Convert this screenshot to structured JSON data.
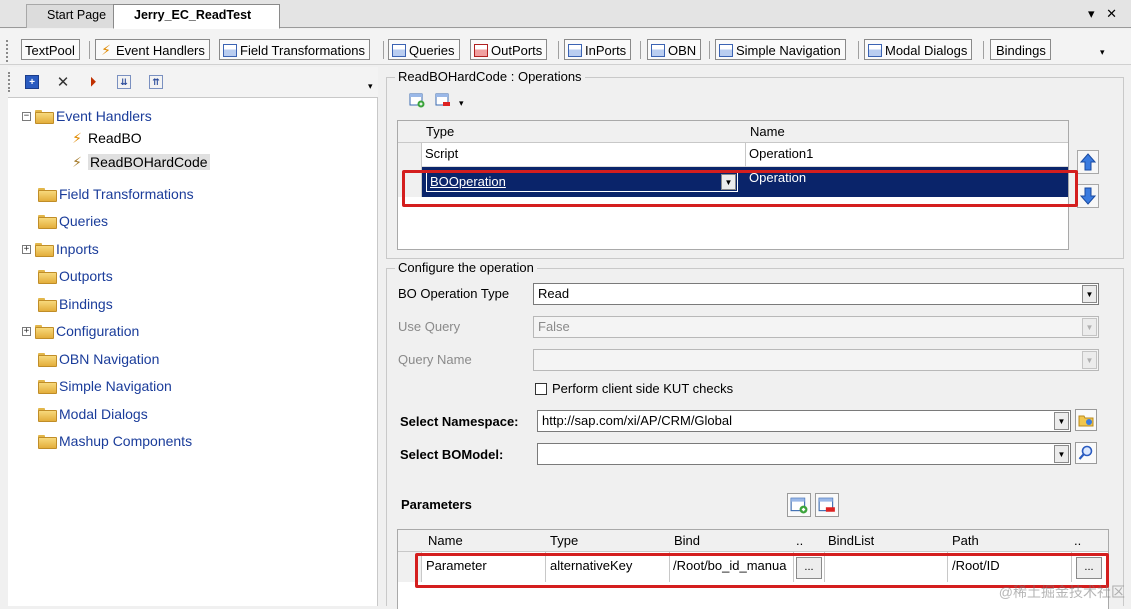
{
  "doc_tabs": {
    "start": "Start Page",
    "active": "Jerry_EC_ReadTest",
    "controls": "▾ ✕"
  },
  "toolbar": {
    "buttons": [
      "TextPool",
      "Event Handlers",
      "Field Transformations",
      "Queries",
      "OutPorts",
      "InPorts",
      "OBN",
      "Simple Navigation",
      "Modal Dialogs",
      "Bindings"
    ]
  },
  "tree": {
    "items": [
      {
        "label": "Event Handlers"
      },
      {
        "label": "ReadBO"
      },
      {
        "label": "ReadBOHardCode"
      },
      {
        "label": "Field Transformations"
      },
      {
        "label": "Queries"
      },
      {
        "label": "Inports"
      },
      {
        "label": "Outports"
      },
      {
        "label": "Bindings"
      },
      {
        "label": "Configuration"
      },
      {
        "label": "OBN Navigation"
      },
      {
        "label": "Simple Navigation"
      },
      {
        "label": "Modal Dialogs"
      },
      {
        "label": "Mashup Components"
      }
    ]
  },
  "operations": {
    "title": "ReadBOHardCode : Operations",
    "columns": {
      "type": "Type",
      "name": "Name"
    },
    "rows": [
      {
        "type": "Script",
        "name": "Operation1"
      },
      {
        "type": "BOOperation",
        "name": "Operation"
      }
    ]
  },
  "configure": {
    "title": "Configure the operation",
    "bo_operation_type_label": "BO Operation Type",
    "bo_operation_type_value": "Read",
    "use_query_label": "Use Query",
    "use_query_value": "False",
    "query_name_label": "Query Name",
    "query_name_value": "",
    "kut_checkbox_label": "Perform client side KUT checks",
    "namespace_label": "Select Namespace:",
    "namespace_value": "http://sap.com/xi/AP/CRM/Global",
    "bomodel_label": "Select BOModel:",
    "bomodel_value": ""
  },
  "parameters": {
    "title": "Parameters",
    "columns": {
      "name": "Name",
      "type": "Type",
      "bind": "Bind",
      "dots1": "..",
      "bindlist": "BindList",
      "path": "Path",
      "dots2": ".."
    },
    "rows": [
      {
        "name": "Parameter",
        "type": "alternativeKey",
        "bind": "/Root/bo_id_manua",
        "bind_btn": "...",
        "bindlist": "",
        "path": "/Root/ID",
        "path_btn": "..."
      }
    ]
  },
  "watermark": "@稀土掘金技术社区",
  "colors": {
    "selection": "#0a246a",
    "highlight_box": "#d41e1e",
    "tree_text": "#1a3c9a"
  }
}
